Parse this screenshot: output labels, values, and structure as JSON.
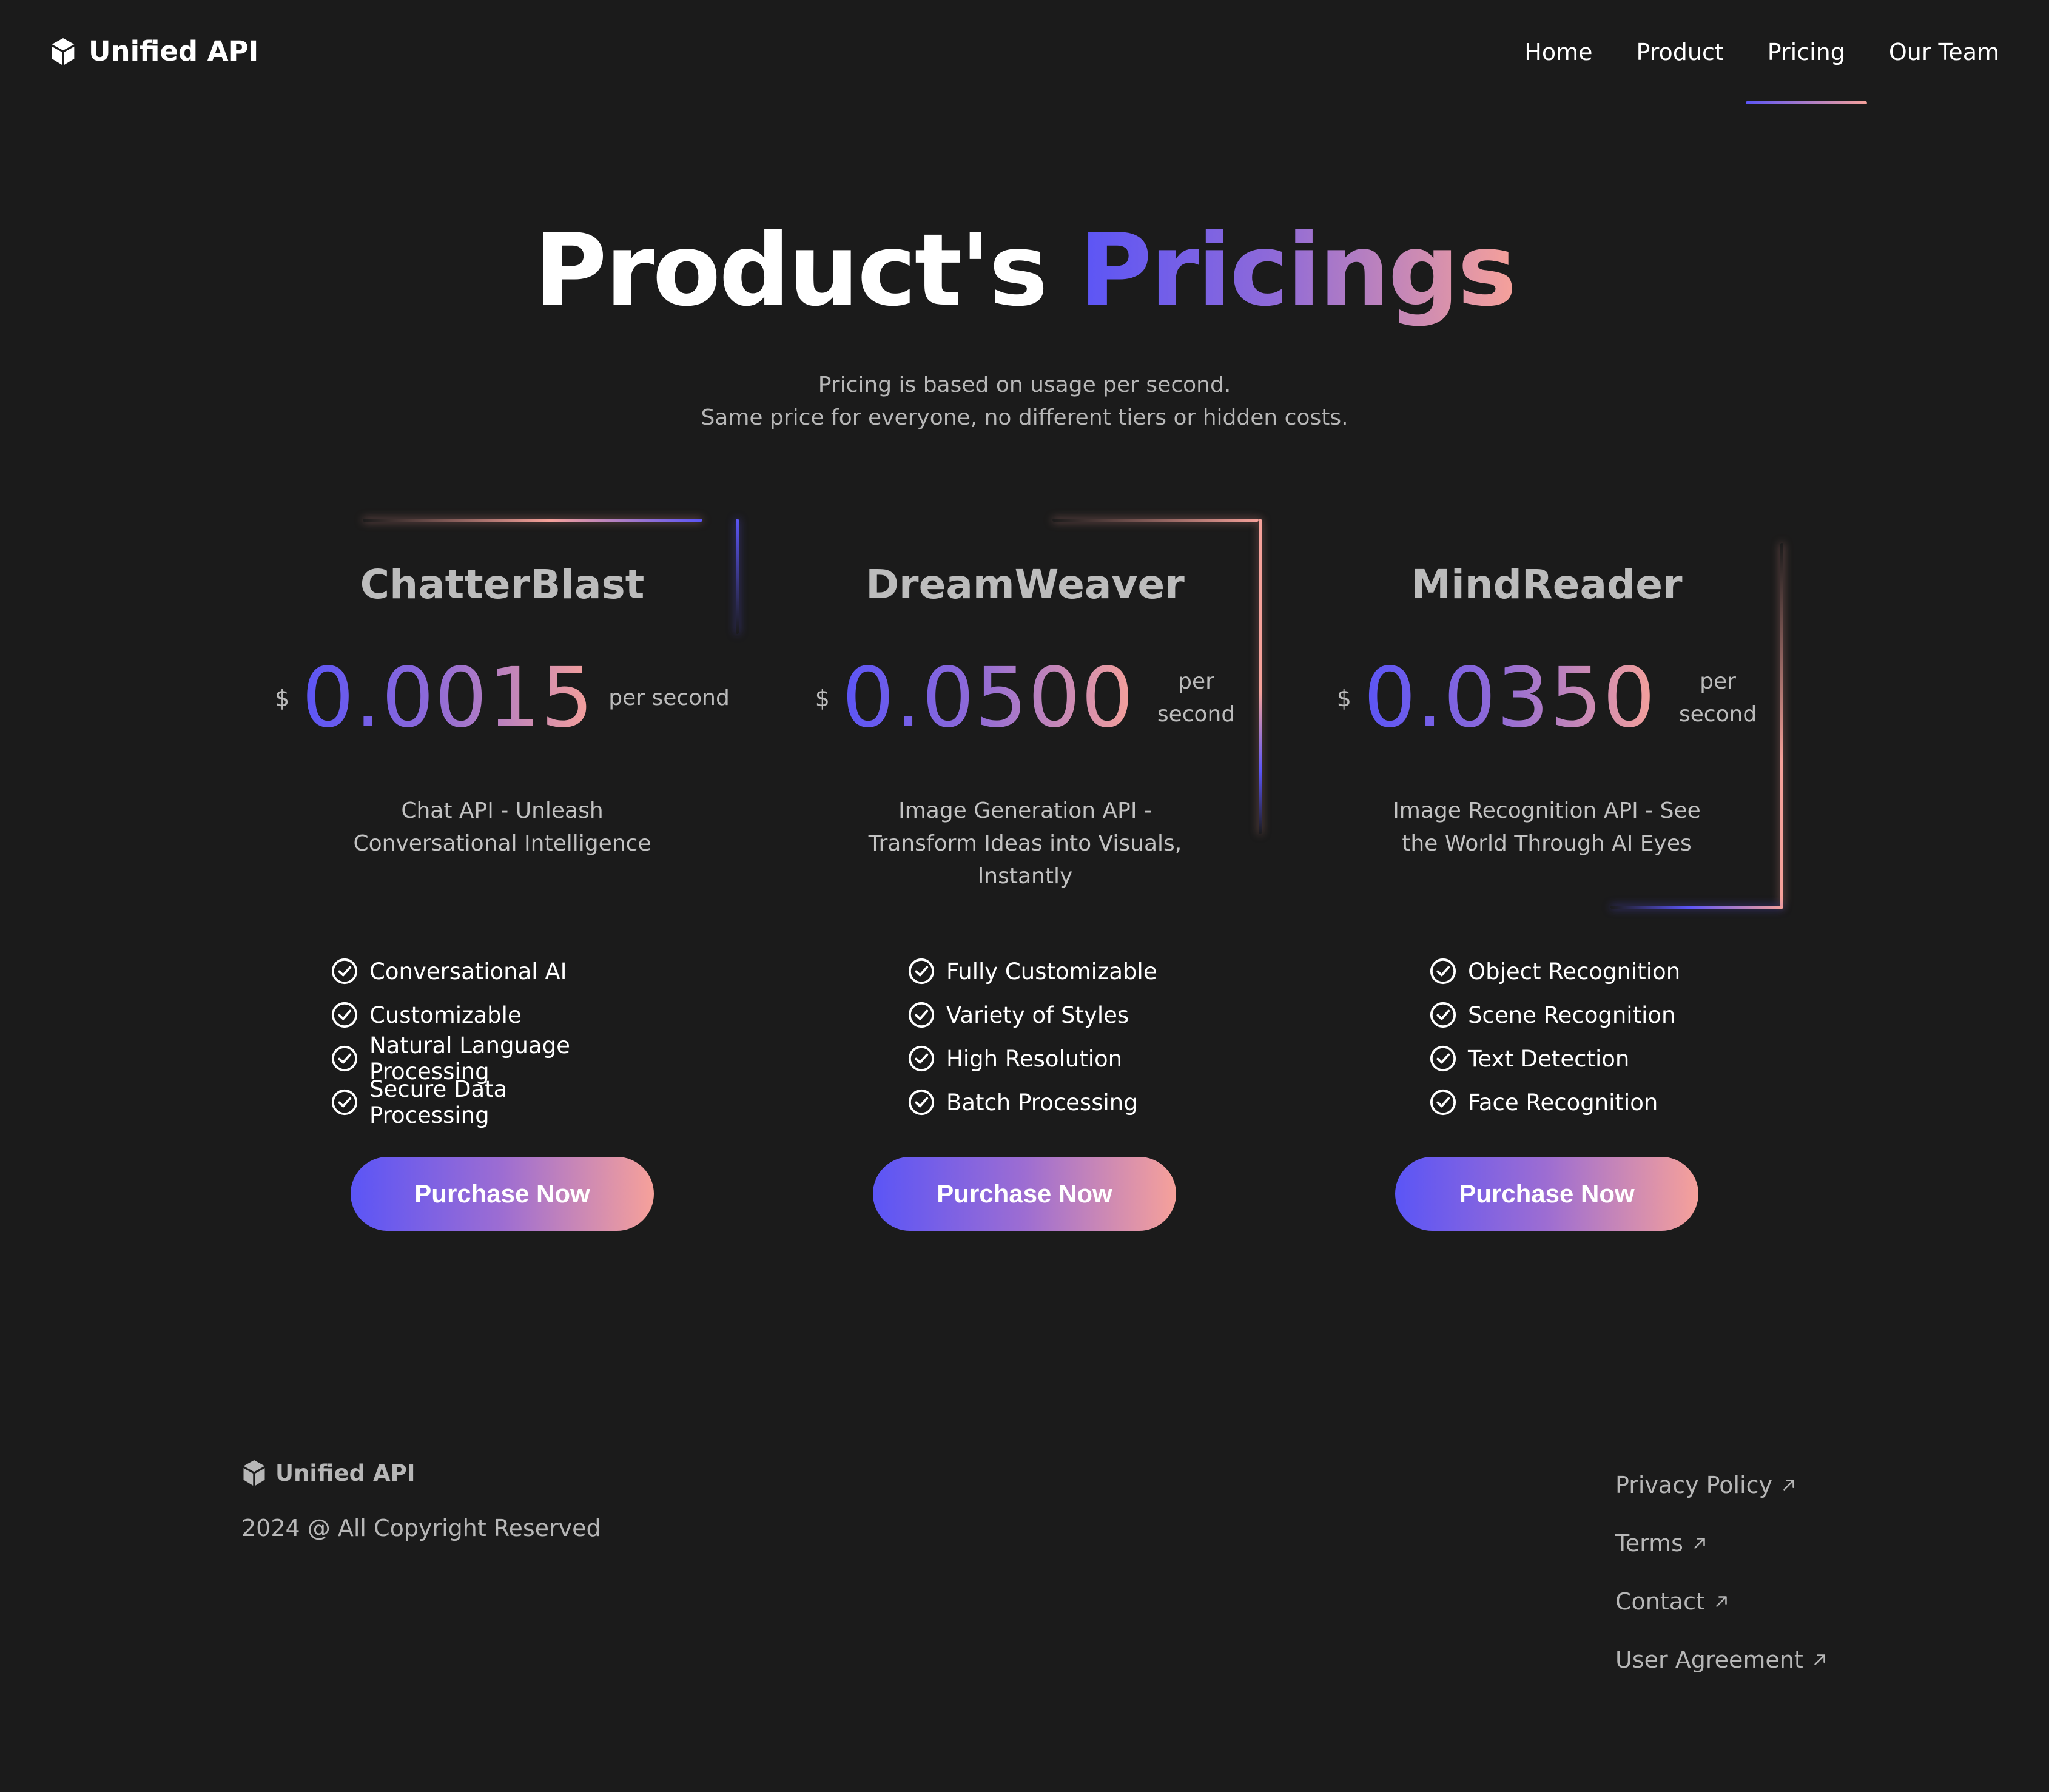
{
  "header": {
    "brand": "Unified API",
    "nav": [
      "Home",
      "Product",
      "Pricing",
      "Our Team"
    ],
    "active_nav": "Pricing"
  },
  "hero": {
    "title_main": "Product's",
    "title_accent": "Pricings",
    "subtitle_line1": "Pricing is based on usage per second.",
    "subtitle_line2": "Same price for everyone, no different tiers or hidden costs."
  },
  "cards": [
    {
      "name": "ChatterBlast",
      "currency": "$",
      "price": "0.0015",
      "unit": "per second",
      "description": "Chat API - Unleash Conversational Intelligence",
      "features": [
        "Conversational AI",
        "Customizable",
        "Natural Language Processing",
        "Secure Data Processing"
      ],
      "button": "Purchase Now"
    },
    {
      "name": "DreamWeaver",
      "currency": "$",
      "price": "0.0500",
      "unit_line1": "per",
      "unit_line2": "second",
      "description": "Image Generation API - Transform Ideas into Visuals, Instantly",
      "features": [
        "Fully Customizable",
        "Variety of Styles",
        "High Resolution",
        "Batch Processing"
      ],
      "button": "Purchase Now"
    },
    {
      "name": "MindReader",
      "currency": "$",
      "price": "0.0350",
      "unit_line1": "per",
      "unit_line2": "second",
      "description": "Image Recognition API - See the World Through AI Eyes",
      "features": [
        "Object Recognition",
        "Scene Recognition",
        "Text Detection",
        "Face Recognition"
      ],
      "button": "Purchase Now"
    }
  ],
  "footer": {
    "brand": "Unified API",
    "copyright": "2024 @ All Copyright Reserved",
    "links": [
      "Privacy Policy",
      "Terms",
      "Contact",
      "User Agreement"
    ]
  },
  "colors": {
    "background": "#1b1b1b",
    "gradient_start": "#5b55f6",
    "gradient_end": "#f6a19a",
    "muted_text": "#b7b7b7"
  }
}
